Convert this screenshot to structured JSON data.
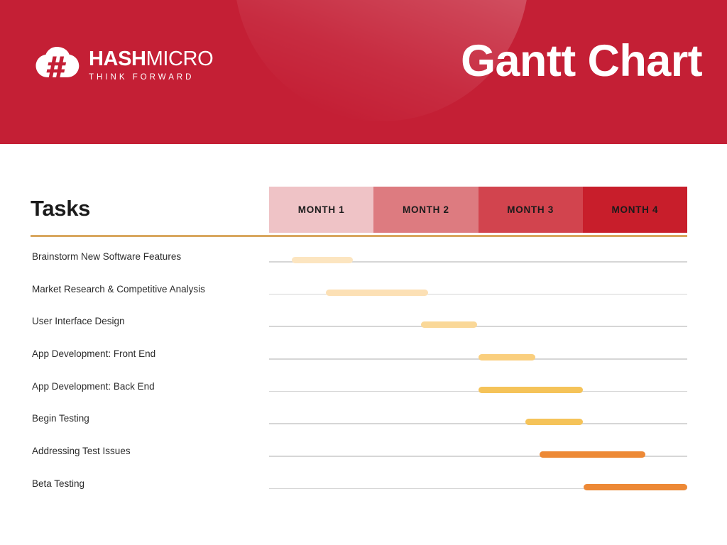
{
  "header": {
    "title": "Gantt Chart",
    "background_color": "#C41F35",
    "logo": {
      "icon": "cloud-hash-logo-icon",
      "name_bold": "HASH",
      "name_light": "MICRO",
      "tagline": "THINK FORWARD"
    }
  },
  "table": {
    "tasks_column_header": "Tasks",
    "divider_color": "#D9A760"
  },
  "chart_data": {
    "type": "bar",
    "title": "Gantt Chart",
    "xlabel": "",
    "ylabel": "Tasks",
    "xlim": [
      0,
      4
    ],
    "grid": false,
    "legend": "none",
    "categories": [
      "Brainstorm New Software Features",
      "Market Research & Competitive Analysis",
      "User Interface Design",
      "App Development: Front End",
      "App Development: Back End",
      "Begin Testing",
      "Addressing Test Issues",
      "Beta Testing"
    ],
    "x_tick_labels": [
      "MONTH 1",
      "MONTH 2",
      "MONTH 3",
      "MONTH 4"
    ],
    "column_colors": [
      "#EFC3C6",
      "#DD7B80",
      "#D2444E",
      "#C81E2B"
    ],
    "bar_colors": [
      "#FCE5C0",
      "#FCE0B5",
      "#FAD898",
      "#FACF7E",
      "#F5C359",
      "#F5C359",
      "#ED8936",
      "#ED8936"
    ],
    "bars": [
      {
        "task": "Brainstorm New Software Features",
        "start": 0.22,
        "end": 0.8,
        "duration": 0.58,
        "color": "#FCE5C0"
      },
      {
        "task": "Market Research & Competitive Analysis",
        "start": 0.54,
        "end": 1.52,
        "duration": 0.98,
        "color": "#FCE0B5"
      },
      {
        "task": "User Interface Design",
        "start": 1.45,
        "end": 1.99,
        "duration": 0.54,
        "color": "#FAD898"
      },
      {
        "task": "App Development: Front End",
        "start": 2.0,
        "end": 2.55,
        "duration": 0.55,
        "color": "#FACF7E"
      },
      {
        "task": "App Development: Back End",
        "start": 2.0,
        "end": 3.0,
        "duration": 1.0,
        "color": "#F5C359"
      },
      {
        "task": "Begin Testing",
        "start": 2.45,
        "end": 3.0,
        "duration": 0.55,
        "color": "#F5C359"
      },
      {
        "task": "Addressing Test Issues",
        "start": 2.59,
        "end": 3.6,
        "duration": 1.01,
        "color": "#ED8936"
      },
      {
        "task": "Beta Testing",
        "start": 3.01,
        "end": 4.0,
        "duration": 0.99,
        "color": "#ED8936"
      }
    ]
  }
}
